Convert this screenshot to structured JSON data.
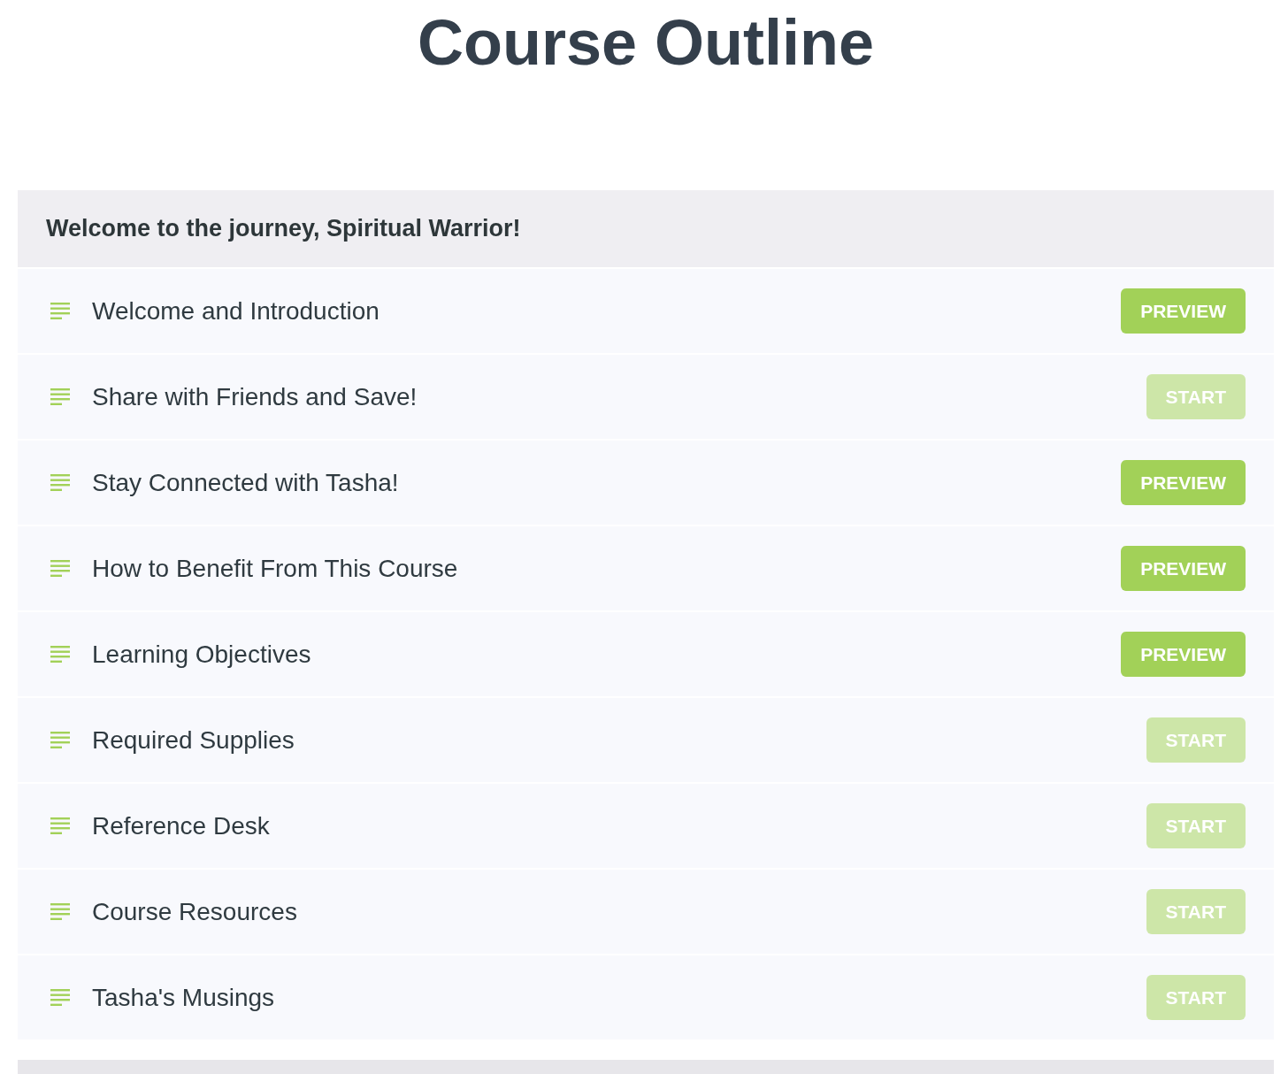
{
  "page": {
    "title": "Course Outline"
  },
  "sections": [
    {
      "title": "Welcome to the journey, Spiritual Warrior!",
      "lessons": [
        {
          "title": "Welcome and Introduction",
          "button": {
            "label": "PREVIEW",
            "disabled": false
          }
        },
        {
          "title": "Share with Friends and Save!",
          "button": {
            "label": "START",
            "disabled": true
          }
        },
        {
          "title": "Stay Connected with Tasha!",
          "button": {
            "label": "PREVIEW",
            "disabled": false
          }
        },
        {
          "title": "How to Benefit From This Course",
          "button": {
            "label": "PREVIEW",
            "disabled": false
          }
        },
        {
          "title": "Learning Objectives",
          "button": {
            "label": "PREVIEW",
            "disabled": false
          }
        },
        {
          "title": "Required Supplies",
          "button": {
            "label": "START",
            "disabled": true
          }
        },
        {
          "title": "Reference Desk",
          "button": {
            "label": "START",
            "disabled": true
          }
        },
        {
          "title": "Course Resources",
          "button": {
            "label": "START",
            "disabled": true
          }
        },
        {
          "title": "Tasha's Musings",
          "button": {
            "label": "START",
            "disabled": true
          }
        }
      ]
    }
  ]
}
